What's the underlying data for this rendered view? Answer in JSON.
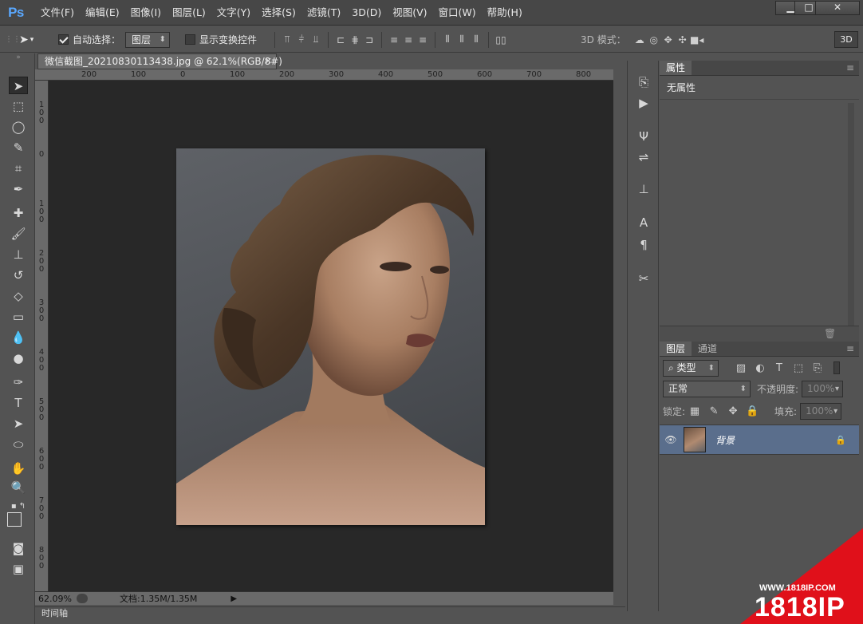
{
  "app": {
    "logo": "Ps"
  },
  "menu": [
    "文件(F)",
    "编辑(E)",
    "图像(I)",
    "图层(L)",
    "文字(Y)",
    "选择(S)",
    "滤镜(T)",
    "3D(D)",
    "视图(V)",
    "窗口(W)",
    "帮助(H)"
  ],
  "window_controls": {
    "minimize": "▁",
    "maximize": "□",
    "close": "✕"
  },
  "options": {
    "auto_select_label": "自动选择：",
    "auto_select_checked": true,
    "auto_select_target": "图层",
    "show_transform_label": "显示变换控件",
    "show_transform_checked": false,
    "mode_3d_label": "3D 模式：",
    "btn_3d": "3D"
  },
  "document": {
    "tab_title": "微信截图_20210830113438.jpg @ 62.1%(RGB/8#)",
    "ruler_h": [
      "200",
      "100",
      "0",
      "100",
      "200",
      "300",
      "400",
      "500",
      "600",
      "700",
      "800"
    ],
    "ruler_v": [
      "1 0 0",
      "0",
      "1 0 0",
      "2 0 0",
      "3 0 0",
      "4 0 0",
      "5 0 0",
      "6 0 0",
      "7 0 0",
      "8 0 0"
    ],
    "zoom": "62.09%",
    "doc_size": "文档:1.35M/1.35M",
    "timeline": "时间轴"
  },
  "properties": {
    "tab": "属性",
    "empty_text": "无属性"
  },
  "layers": {
    "tab_layers": "图层",
    "tab_channels": "通道",
    "filter_kind": "类型",
    "blend_mode": "正常",
    "opacity_label": "不透明度:",
    "opacity_value": "100%",
    "lock_label": "锁定:",
    "fill_label": "填充:",
    "fill_value": "100%",
    "items": [
      {
        "name": "背景",
        "visible": true,
        "locked": true
      }
    ]
  },
  "watermark": {
    "url": "WWW.1818IP.COM",
    "brand": "1818IP",
    "color": "#e0101a"
  }
}
